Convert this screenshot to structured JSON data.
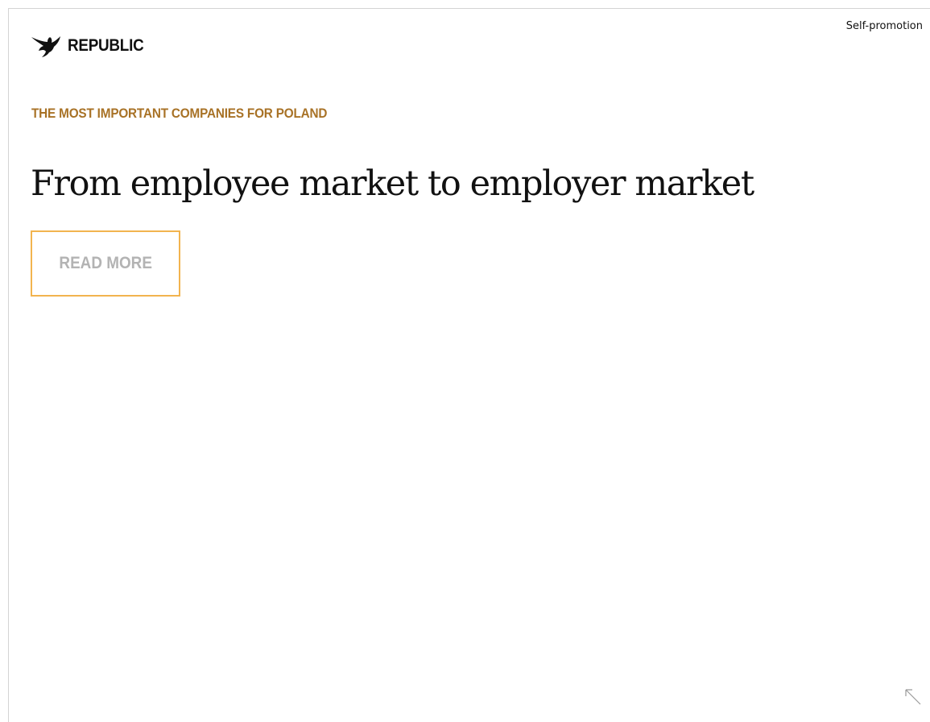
{
  "ad": {
    "label": "Self-promotion",
    "brand": {
      "name": "REPUBLIC",
      "logo_icon": "eagle-logo-icon"
    },
    "kicker": "THE MOST IMPORTANT COMPANIES FOR POLAND",
    "headline": "From employee market to employer market",
    "cta_label": "READ MORE",
    "expand_icon": "expand-arrow-icon"
  },
  "colors": {
    "kicker": "#a87226",
    "button_border": "#f2b44f",
    "button_text": "#b3b3b3",
    "text": "#111111",
    "frame_border": "#d4d4d4"
  }
}
